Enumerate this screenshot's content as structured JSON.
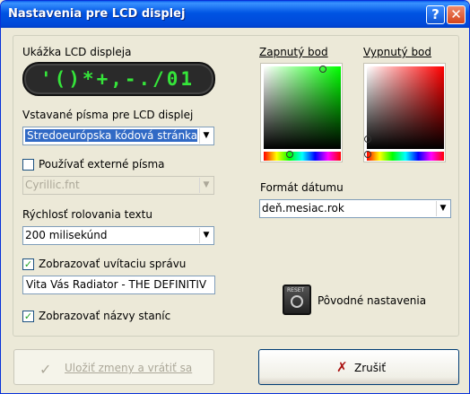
{
  "window": {
    "title": "Nastavenia pre LCD displej",
    "help_glyph": "?",
    "close_glyph": "✕"
  },
  "lcd_preview": {
    "label": "Ukážka LCD displeja",
    "text": "'()*+,-./01"
  },
  "builtin_fonts": {
    "label": "Vstavané písma pre LCD displej",
    "selected": "Stredoeurópska kódová stránka"
  },
  "external_fonts": {
    "checkbox_label": "Používať externé písma",
    "checked": false,
    "selected": "Cyrillic.fnt"
  },
  "scroll_speed": {
    "label": "Rýchlosť rolovania textu",
    "selected": "200 milisekúnd"
  },
  "welcome": {
    "checkbox_label": "Zobrazovať uvítaciu správu",
    "checked": true,
    "message": "Vita Vás Radiator - THE DEFINITIV"
  },
  "station_names": {
    "checkbox_label": "Zobrazovať názvy staníc",
    "checked": true
  },
  "colors": {
    "on_label": "Zapnutý bod",
    "off_label": "Vypnutý bod",
    "on_hue": "#00ff00",
    "off_hue": "#ff0000"
  },
  "date_format": {
    "label": "Formát dátumu",
    "selected": "deň.mesiac.rok"
  },
  "reset": {
    "icon_text": "RESET",
    "label": "Pôvodné nastavenia"
  },
  "buttons": {
    "save_label": "Uložiť zmeny a vrátiť sa",
    "cancel_label": "Zrušiť"
  }
}
